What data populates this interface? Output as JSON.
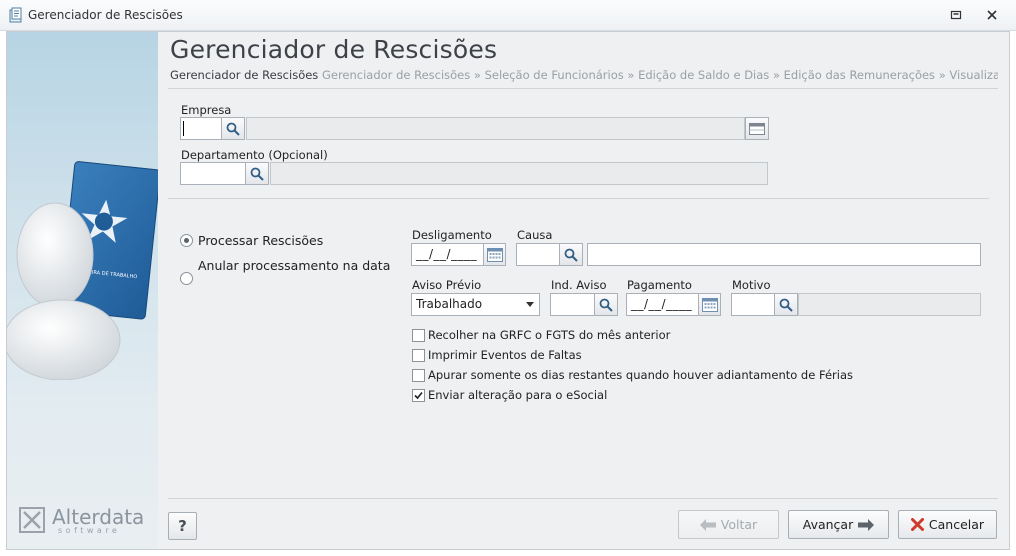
{
  "window": {
    "title": "Gerenciador de Rescisões",
    "icon": "app-window-icon",
    "controls": [
      "restore-icon",
      "close-icon"
    ]
  },
  "header": {
    "title": "Gerenciador de Rescisões",
    "breadcrumb": {
      "current": "Gerenciador de Rescisões",
      "trail": "Gerenciador de Rescisões » Seleção de Funcionários » Edição de Saldo e Dias » Edição das Remunerações » Visualizar cálculos reali:"
    }
  },
  "sidebar": {
    "illustration": "carteira-de-trabalho-avatar",
    "card_text": "CARTEIRA DE TRABALHO",
    "brand": {
      "name": "Alterdata",
      "sub": "software"
    }
  },
  "form": {
    "empresa": {
      "label": "Empresa",
      "code": "",
      "name": ""
    },
    "departamento": {
      "label": "Departamento (Opcional)",
      "code": "",
      "name": ""
    },
    "radios": [
      {
        "label": "Processar Rescisões",
        "selected": true
      },
      {
        "label": "Anular processamento na data",
        "selected": false
      }
    ],
    "desligamento": {
      "label": "Desligamento",
      "value": "__/__/____"
    },
    "causa": {
      "label": "Causa",
      "code": "",
      "name": ""
    },
    "aviso_previo": {
      "label": "Aviso Prévio",
      "value": "Trabalhado"
    },
    "ind_aviso": {
      "label": "Ind. Aviso",
      "value": ""
    },
    "pagamento": {
      "label": "Pagamento",
      "value": "__/__/____"
    },
    "motivo": {
      "label": "Motivo",
      "code": "",
      "name": ""
    },
    "checks": [
      {
        "label": "Recolher na GRFC o FGTS do mês anterior",
        "checked": false
      },
      {
        "label": "Imprimir Eventos de Faltas",
        "checked": false
      },
      {
        "label": "Apurar somente os dias restantes quando houver adiantamento de Férias",
        "checked": false
      },
      {
        "label": "Enviar alteração para o eSocial",
        "checked": true
      }
    ]
  },
  "footer": {
    "help": "?",
    "voltar": "Voltar",
    "avancar": "Avançar",
    "cancelar": "Cancelar"
  },
  "colors": {
    "accent_red": "#d0392b",
    "brand_gray": "#8b959e",
    "panel_bg": "#eef0f2",
    "sidebar_top": "#b7d4e4"
  }
}
